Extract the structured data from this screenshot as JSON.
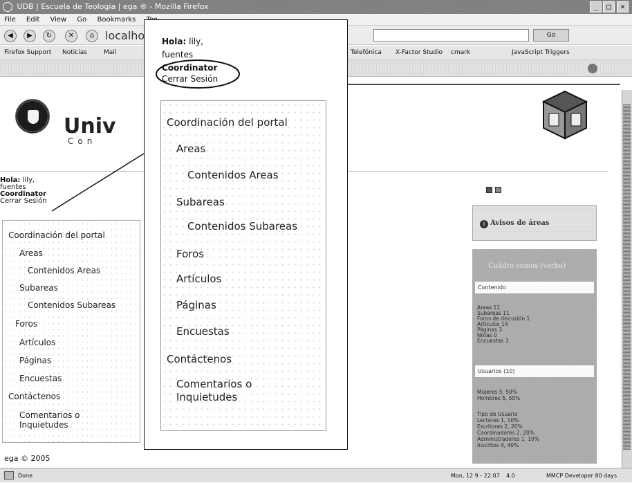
{
  "window": {
    "title": "UDB | Escuela de Teologia | ega ® - Mozilla Firefox",
    "controls": [
      "_",
      "□",
      "×"
    ]
  },
  "menu": [
    "File",
    "Edit",
    "View",
    "Go",
    "Bookmarks",
    "Too"
  ],
  "navigation": {
    "url_partial": "localho",
    "go_label": "Go"
  },
  "bookmarks": [
    "Firefox Support",
    "Noticias",
    "Mail",
    "Telefónica",
    "X-Factor Studio",
    "cmark",
    "JavaScript Triggers"
  ],
  "header": {
    "title_partial": "Univ",
    "subtitle_partial": "Con"
  },
  "login": {
    "greeting_label": "Hola:",
    "username": "lily,",
    "lastname": "fuentes",
    "role": "Coordinator",
    "logout": "Cerrar Sesión"
  },
  "menu_items": [
    {
      "label": "Coordinación del portal"
    },
    {
      "label": "Areas"
    },
    {
      "label": "Contenidos Areas"
    },
    {
      "label": "Subareas"
    },
    {
      "label": "Contenidos Subareas"
    },
    {
      "label": "Foros"
    },
    {
      "label": "Artículos"
    },
    {
      "label": "Páginas"
    },
    {
      "label": "Encuestas"
    },
    {
      "label": "Contáctenos"
    },
    {
      "label": "Comentarios o Inquietudes"
    }
  ],
  "footer": {
    "copyright": "ega © 2005"
  },
  "sidebar_right": {
    "avisos_label": "Avisos de áreas",
    "stats_title": "Cuádro somos (verbo)",
    "contenido_header": "Contenido",
    "contenido_lines": [
      "Areas 11",
      "Subareas 11",
      "Foros de discusión 1",
      "Artículos 14",
      "Páginas 3",
      "Notas 0",
      "Encuestas 3"
    ],
    "usuarios_header": "Usuarios (10)",
    "usuarios_lines": [
      "Mujeres 5, 50%",
      "Hombres 5, 50%"
    ],
    "tipos_lines": [
      "Tipo de Usuario",
      "Lectores 1, 10%",
      "Escritores 2, 20%",
      "Coordinadores 2, 20%",
      "Administradores 1, 10%",
      "Inscritos 4, 40%"
    ]
  },
  "status": {
    "left": "Done",
    "date": "Mon, 12 9 - 22:07",
    "number": "4.0",
    "right": "MMCP Developer 80 days"
  }
}
